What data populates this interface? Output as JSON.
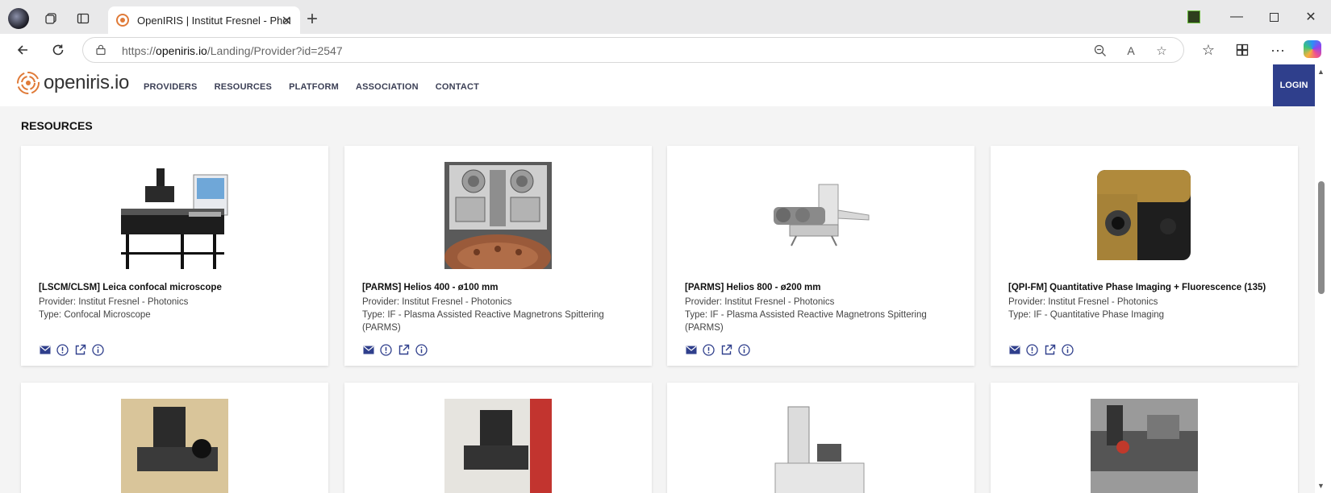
{
  "browser": {
    "tab_title": "OpenIRIS | Institut Fresnel - Photonics",
    "url_prefix": "https://",
    "url_host": "openiris.io",
    "url_path": "/Landing/Provider?id=2547"
  },
  "site": {
    "logo_text": "openiris.io",
    "nav": [
      "PROVIDERS",
      "RESOURCES",
      "PLATFORM",
      "ASSOCIATION",
      "CONTACT"
    ],
    "login_label": "LOGIN",
    "section_title": "RESOURCES"
  },
  "cards": [
    {
      "title": "[LSCM/CLSM] Leica confocal microscope",
      "provider": "Provider: Institut Fresnel - Photonics",
      "type": "Type: Confocal Microscope",
      "type_cont": ""
    },
    {
      "title": "[PARMS] Helios 400 - ø100 mm",
      "provider": "Provider: Institut Fresnel - Photonics",
      "type": "Type: IF - Plasma Assisted Reactive Magnetrons Spittering",
      "type_cont": "(PARMS)"
    },
    {
      "title": "[PARMS] Helios 800 - ø200 mm",
      "provider": "Provider: Institut Fresnel - Photonics",
      "type": "Type: IF - Plasma Assisted Reactive Magnetrons Spittering",
      "type_cont": "(PARMS)"
    },
    {
      "title": "[QPI-FM] Quantitative Phase Imaging + Fluorescence (135)",
      "provider": "Provider: Institut Fresnel - Photonics",
      "type": "Type: IF - Quantitative Phase Imaging",
      "type_cont": ""
    }
  ],
  "card_actions": [
    "mail-icon",
    "alert-icon",
    "external-link-icon",
    "info-icon"
  ],
  "colors": {
    "accent": "#2f3f8c",
    "logo_orange": "#e07b39"
  }
}
